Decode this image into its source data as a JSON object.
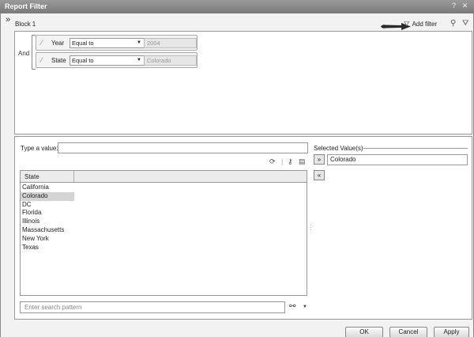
{
  "window": {
    "title": "Report Filter"
  },
  "block": {
    "label": "Block 1"
  },
  "toolbar": {
    "add_filter_label": "Add filter"
  },
  "conditions": {
    "operator_group": "And",
    "items": [
      {
        "field": "Year",
        "operator": "Equal to",
        "value": "2004"
      },
      {
        "field": "State",
        "operator": "Equal to",
        "value": "Colorado"
      }
    ]
  },
  "values_panel": {
    "type_label": "Type a value:",
    "type_value": "",
    "list_header": "State",
    "list_items": [
      "California",
      "Colorado",
      "DC",
      "Florida",
      "Illinois",
      "Massachusetts",
      "New York",
      "Texas"
    ],
    "selected_list_item": "Colorado",
    "selected_label": "Selected Value(s)",
    "selected_values": [
      "Colorado"
    ],
    "move_right": "»",
    "move_left": "«",
    "search_placeholder": "Enter search pattern"
  },
  "footer": {
    "ok": "OK",
    "cancel": "Cancel",
    "apply": "Apply"
  }
}
